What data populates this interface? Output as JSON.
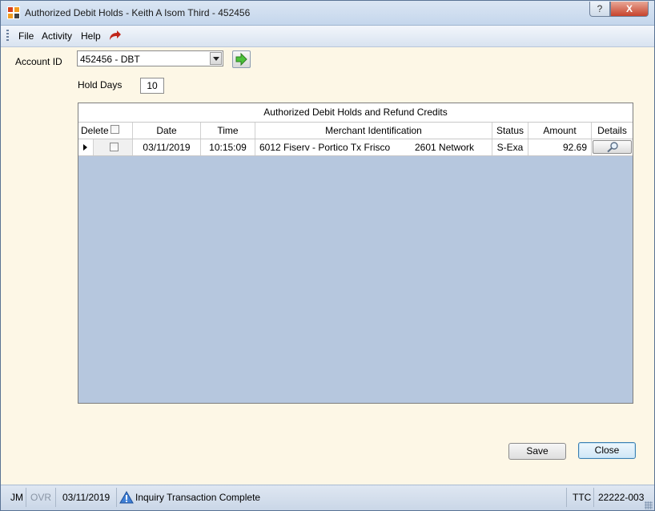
{
  "window": {
    "title": "Authorized Debit Holds - Keith A Isom Third - 452456",
    "help_label": "?",
    "close_label": "X"
  },
  "menu": {
    "file": "File",
    "activity": "Activity",
    "help": "Help"
  },
  "form": {
    "account_label": "Account ID",
    "account_value": "452456 - DBT",
    "hold_days_label": "Hold Days",
    "hold_days_value": "10"
  },
  "grid": {
    "title": "Authorized Debit Holds and Refund Credits",
    "columns": {
      "delete": "Delete",
      "date": "Date",
      "time": "Time",
      "merchant": "Merchant Identification",
      "status": "Status",
      "amount": "Amount",
      "details": "Details"
    },
    "rows": [
      {
        "date": "03/11/2019",
        "time": "10:15:09",
        "merchant": "6012 Fiserv - Portico Tx Frisco",
        "network": "2601 Network",
        "status": "S-Exa",
        "amount": "92.69"
      }
    ]
  },
  "buttons": {
    "save": "Save",
    "close": "Close"
  },
  "status": {
    "user": "JM",
    "mode": "OVR",
    "date": "03/11/2019",
    "message": "Inquiry Transaction Complete",
    "code1": "TTC",
    "code2": "22222-003"
  },
  "colors": {
    "grid_background": "#b6c7de",
    "form_background": "#fdf7e6"
  }
}
